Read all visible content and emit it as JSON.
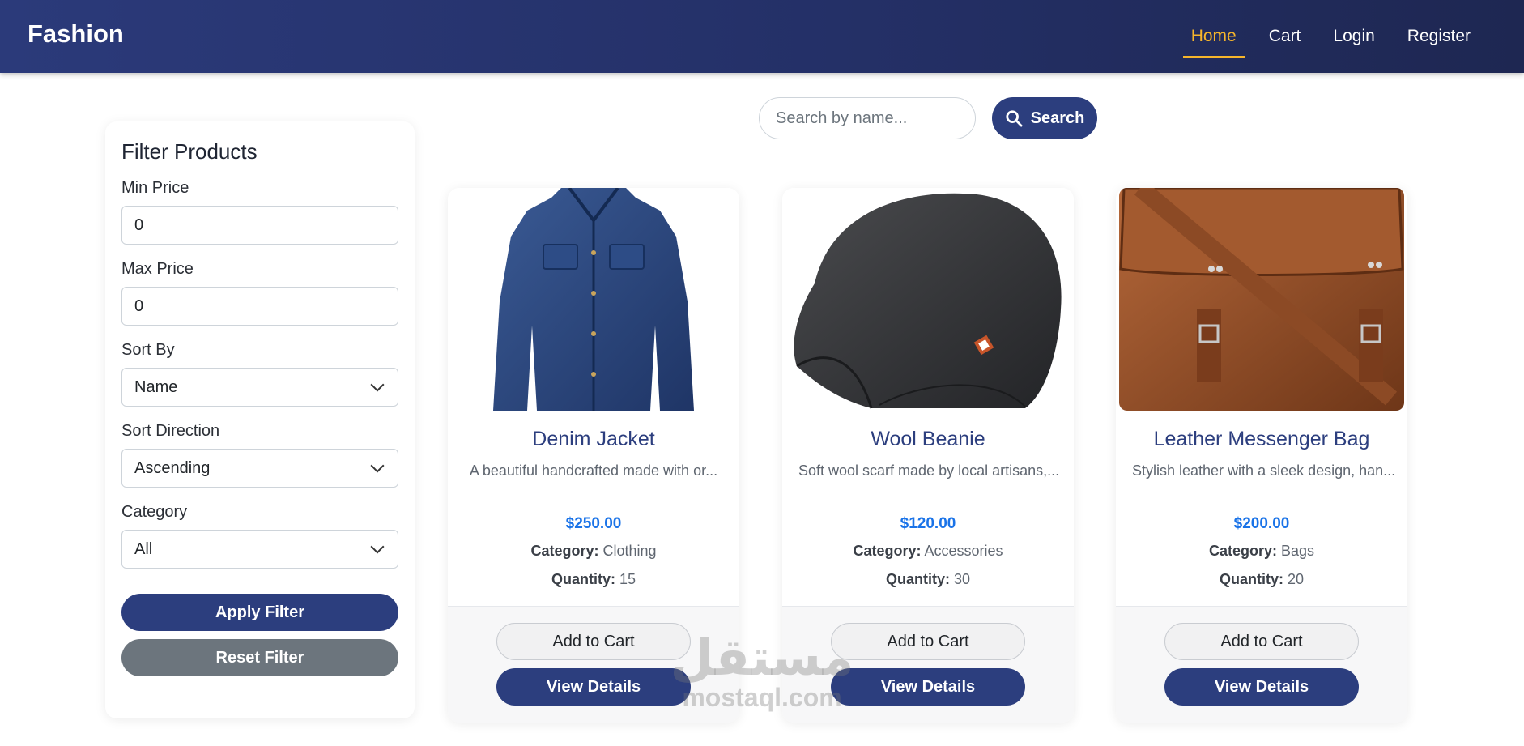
{
  "navbar": {
    "brand": "Fashion",
    "links": [
      {
        "label": "Home",
        "active": true
      },
      {
        "label": "Cart",
        "active": false
      },
      {
        "label": "Login",
        "active": false
      },
      {
        "label": "Register",
        "active": false
      }
    ]
  },
  "search": {
    "placeholder": "Search by name...",
    "button_label": "Search"
  },
  "filter": {
    "title": "Filter Products",
    "min_price_label": "Min Price",
    "min_price_value": "0",
    "max_price_label": "Max Price",
    "max_price_value": "0",
    "sort_by_label": "Sort By",
    "sort_by_value": "Name",
    "sort_direction_label": "Sort Direction",
    "sort_direction_value": "Ascending",
    "category_label": "Category",
    "category_value": "All",
    "apply_label": "Apply Filter",
    "reset_label": "Reset Filter"
  },
  "products": [
    {
      "name": "Denim Jacket",
      "description": "A beautiful handcrafted made with or...",
      "price": "$250.00",
      "category_label": "Category:",
      "category": "Clothing",
      "quantity_label": "Quantity:",
      "quantity": "15",
      "add_to_cart_label": "Add to Cart",
      "view_details_label": "View Details"
    },
    {
      "name": "Wool Beanie",
      "description": "Soft wool scarf made by local artisans,...",
      "price": "$120.00",
      "category_label": "Category:",
      "category": "Accessories",
      "quantity_label": "Quantity:",
      "quantity": "30",
      "add_to_cart_label": "Add to Cart",
      "view_details_label": "View Details"
    },
    {
      "name": "Leather Messenger Bag",
      "description": "Stylish leather with a sleek design, han...",
      "price": "$200.00",
      "category_label": "Category:",
      "category": "Bags",
      "quantity_label": "Quantity:",
      "quantity": "20",
      "add_to_cart_label": "Add to Cart",
      "view_details_label": "View Details"
    }
  ],
  "watermark": {
    "arabic": "مستقل",
    "latin": "mostaql.com"
  },
  "colors": {
    "navbar": "#2b3a7a",
    "active_link": "#f6b52b",
    "primary": "#2c3e7e",
    "secondary": "#6c757d",
    "price": "#1a73e8"
  },
  "icons": {
    "search_button": "search-icon",
    "select_caret": "chevron-down-icon"
  }
}
